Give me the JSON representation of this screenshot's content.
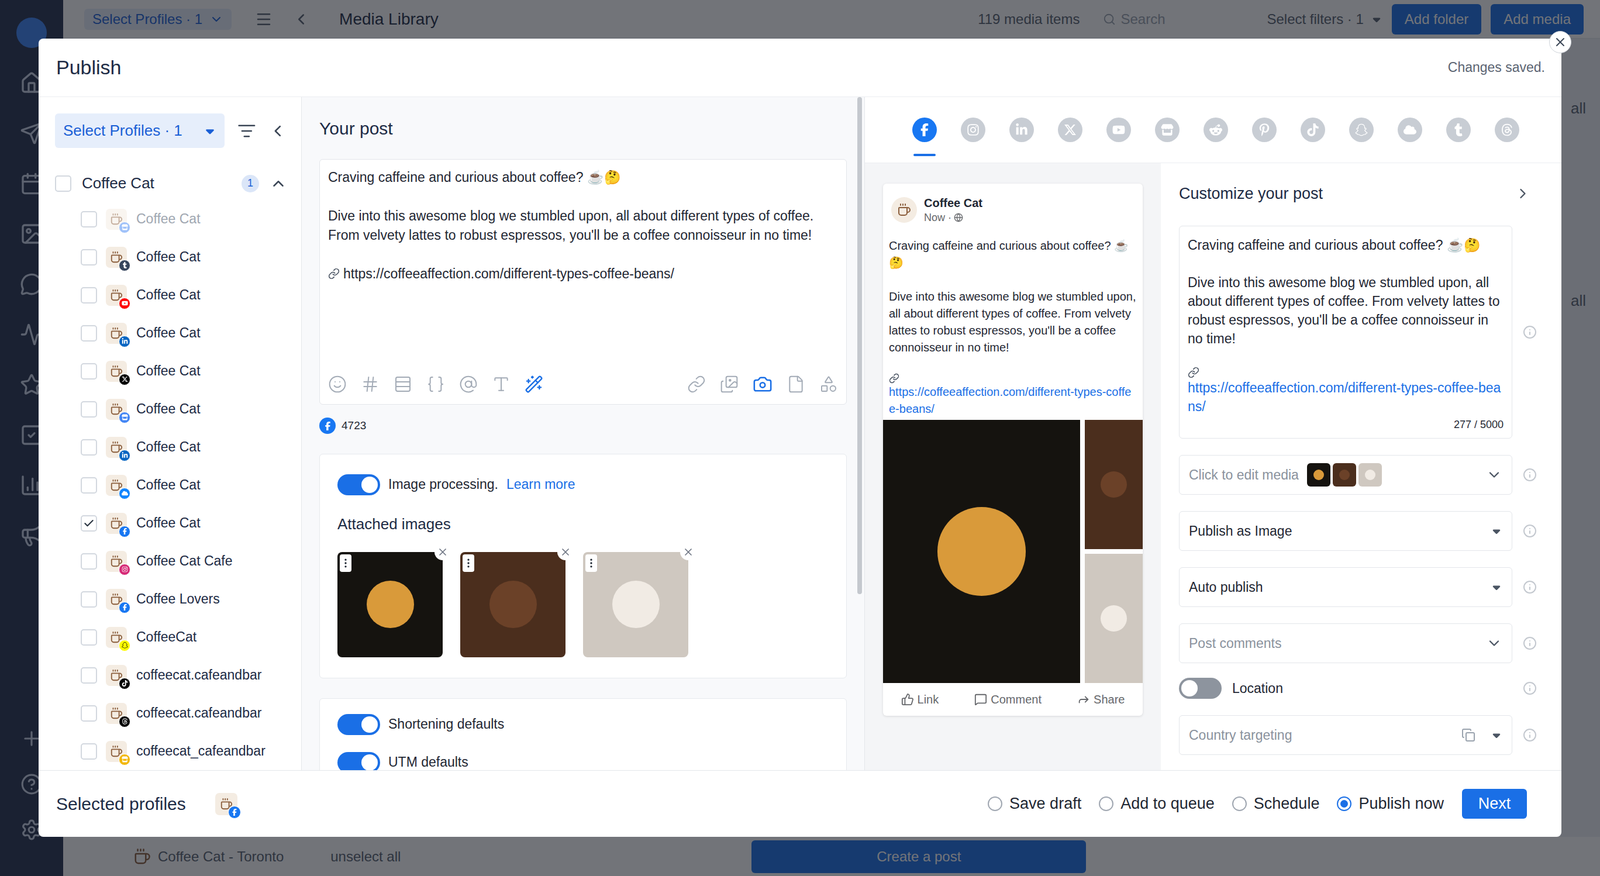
{
  "backdrop": {
    "top_bar": {
      "profiles": "Select Profiles · 1",
      "title": "Media Library",
      "count": "119 media items",
      "search_placeholder": "Search",
      "filters": "Select filters · 1",
      "buttons": [
        "Add folder",
        "Add media"
      ]
    },
    "side_labels": [
      "all",
      "all"
    ],
    "bottom_bar": {
      "profile": "Coffee Cat - Toronto",
      "unselect": "unselect all",
      "create": "Create a post"
    }
  },
  "window": {
    "title": "Publish",
    "status": "Changes saved."
  },
  "profiles": {
    "selector": "Select Profiles · 1",
    "group": {
      "name": "Coffee Cat",
      "count": "1",
      "checked": false,
      "expanded": true
    },
    "items": [
      {
        "name": "Coffee Cat",
        "kind": "google-business",
        "checked": false,
        "disabled": true
      },
      {
        "name": "Coffee Cat",
        "kind": "tumblr",
        "checked": false,
        "disabled": false
      },
      {
        "name": "Coffee Cat",
        "kind": "youtube",
        "checked": false,
        "disabled": false
      },
      {
        "name": "Coffee Cat",
        "kind": "linkedin",
        "checked": false,
        "disabled": false
      },
      {
        "name": "Coffee Cat",
        "kind": "x",
        "checked": false,
        "disabled": false
      },
      {
        "name": "Coffee Cat",
        "kind": "google-business",
        "checked": false,
        "disabled": false
      },
      {
        "name": "Coffee Cat",
        "kind": "linkedin",
        "checked": false,
        "disabled": false
      },
      {
        "name": "Coffee Cat",
        "kind": "bluesky",
        "checked": false,
        "disabled": false
      },
      {
        "name": "Coffee Cat",
        "kind": "facebook",
        "checked": true,
        "disabled": false
      },
      {
        "name": "Coffee Cat Cafe",
        "kind": "instagram",
        "checked": false,
        "disabled": false
      },
      {
        "name": "Coffee Lovers",
        "kind": "facebook",
        "checked": false,
        "disabled": false
      },
      {
        "name": "CoffeeCat",
        "kind": "snapchat",
        "checked": false,
        "disabled": false
      },
      {
        "name": "coffeecat.cafeandbar",
        "kind": "tiktok",
        "checked": false,
        "disabled": false
      },
      {
        "name": "coffeecat.cafeandbar",
        "kind": "threads",
        "checked": false,
        "disabled": false
      },
      {
        "name": "coffeecat_cafeandbar",
        "kind": "other",
        "checked": false,
        "disabled": false
      }
    ]
  },
  "post": {
    "title": "Your post",
    "paragraphs": [
      "Craving caffeine and curious about coffee? ☕🤔",
      "Dive into this awesome blog we stumbled upon, all about different types of coffee. From velvety lattes to robust espressos, you'll be a coffee connoisseur in no time!"
    ],
    "link": "https://coffeeaffection.com/different-types-coffee-beans/",
    "count_network": "facebook",
    "char_count": "4723",
    "image_processing": {
      "on": true,
      "label": "Image processing.",
      "link": "Learn more"
    },
    "attached_title": "Attached images",
    "images": [
      {
        "kind": "latte"
      },
      {
        "kind": "beans"
      },
      {
        "kind": "pour"
      }
    ],
    "toggles": [
      {
        "label": "Shortening defaults",
        "on": true
      },
      {
        "label": "UTM defaults",
        "on": true
      }
    ]
  },
  "preview": {
    "networks": [
      {
        "kind": "facebook",
        "selected": true
      },
      {
        "kind": "instagram",
        "selected": false
      },
      {
        "kind": "linkedin",
        "selected": false
      },
      {
        "kind": "x",
        "selected": false
      },
      {
        "kind": "youtube",
        "selected": false
      },
      {
        "kind": "google-business",
        "selected": false
      },
      {
        "kind": "reddit",
        "selected": false
      },
      {
        "kind": "pinterest",
        "selected": false
      },
      {
        "kind": "tiktok",
        "selected": false
      },
      {
        "kind": "snapchat",
        "selected": false
      },
      {
        "kind": "bluesky",
        "selected": false
      },
      {
        "kind": "tumblr",
        "selected": false
      },
      {
        "kind": "threads",
        "selected": false
      }
    ],
    "card": {
      "name": "Coffee Cat",
      "time": "Now ·",
      "paragraphs": [
        "Craving caffeine and curious about coffee? ☕🤔",
        "Dive into this awesome blog we stumbled upon, all about different types of coffee. From velvety lattes to robust espressos, you'll be a coffee connoisseur in no time!"
      ],
      "link": "https://coffeeaffection.com/different-types-coffee-beans/",
      "images": [
        {
          "kind": "latte"
        },
        {
          "kind": "beans"
        },
        {
          "kind": "pour"
        }
      ],
      "actions": [
        "Link",
        "Comment",
        "Share"
      ]
    }
  },
  "customize": {
    "title": "Customize your post",
    "paragraphs": [
      "Craving caffeine and curious about coffee? ☕🤔",
      "Dive into this awesome blog we stumbled upon, all about different types of coffee. From velvety lattes to robust espressos, you'll be a coffee connoisseur in no time!"
    ],
    "link": "https://coffeeaffection.com/different-types-coffee-beans/",
    "count": "277 / 5000",
    "fields": [
      {
        "kind": "media",
        "label": "Click to edit media",
        "placeholder": true,
        "thumbs": [
          {
            "kind": "latte"
          },
          {
            "kind": "beans"
          },
          {
            "kind": "pour"
          }
        ]
      },
      {
        "kind": "select",
        "label": "Publish as Image",
        "placeholder": false
      },
      {
        "kind": "select",
        "label": "Auto publish",
        "placeholder": false
      },
      {
        "kind": "accordion",
        "label": "Post comments",
        "placeholder": true
      },
      {
        "kind": "toggle",
        "label": "Location",
        "on": false
      },
      {
        "kind": "targeting",
        "label": "Country targeting",
        "placeholder": true
      }
    ]
  },
  "footer": {
    "label": "Selected profiles",
    "selected_profiles": [
      {
        "kind": "facebook"
      }
    ],
    "options": [
      {
        "label": "Save draft",
        "selected": false
      },
      {
        "label": "Add to queue",
        "selected": false
      },
      {
        "label": "Schedule",
        "selected": false
      },
      {
        "label": "Publish now",
        "selected": true
      }
    ],
    "next": "Next"
  }
}
